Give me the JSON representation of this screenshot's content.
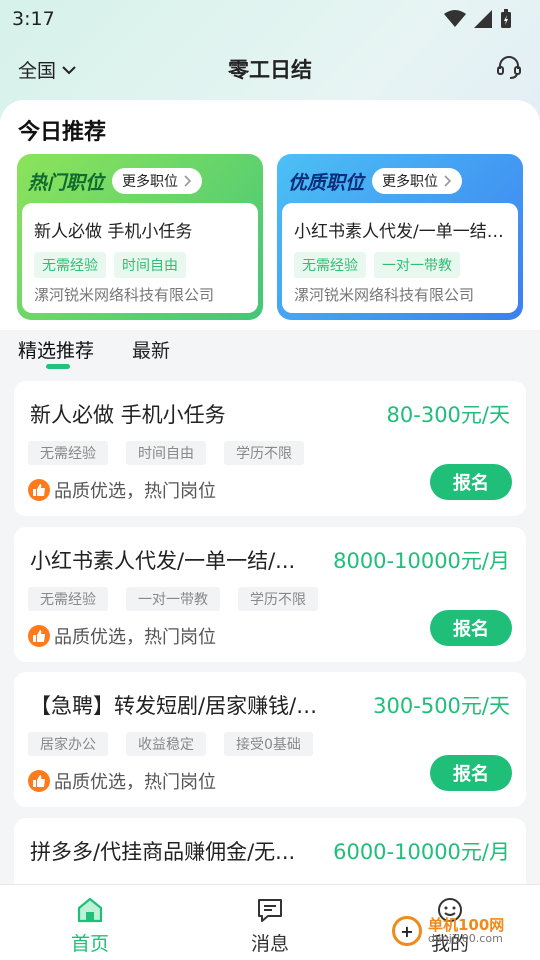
{
  "status_bar": {
    "time": "3:17"
  },
  "header": {
    "region": "全国",
    "title": "零工日结"
  },
  "section": {
    "title": "今日推荐"
  },
  "promos": [
    {
      "heading": "热门职位",
      "more": "更多职位",
      "job": "新人必做 手机小任务",
      "tags": [
        "无需经验",
        "时间自由"
      ],
      "company": "漯河锐米网络科技有限公司"
    },
    {
      "heading": "优质职位",
      "more": "更多职位",
      "job": "小红书素人代发/一单一结/...",
      "tags": [
        "无需经验",
        "一对一带教"
      ],
      "company": "漯河锐米网络科技有限公司"
    }
  ],
  "tabs": {
    "active": "精选推荐",
    "inactive": "最新"
  },
  "jobs": [
    {
      "title": "新人必做 手机小任务",
      "salary": "80-300元/天",
      "tags": [
        "无需经验",
        "时间自由",
        "学历不限"
      ],
      "quality": "品质优选，热门岗位",
      "apply": "报名"
    },
    {
      "title": "小红书素人代发/一单一结/...",
      "salary": "8000-10000元/月",
      "tags": [
        "无需经验",
        "一对一带教",
        "学历不限"
      ],
      "quality": "品质优选，热门岗位",
      "apply": "报名"
    },
    {
      "title": "【急聘】转发短剧/居家赚钱/日结",
      "salary": "300-500元/天",
      "tags": [
        "居家办公",
        "收益稳定",
        "接受0基础"
      ],
      "quality": "品质优选，热门岗位",
      "apply": "报名"
    },
    {
      "title": "拼多多/代挂商品赚佣金/无...",
      "salary": "6000-10000元/月",
      "tags": [],
      "quality": "",
      "apply": ""
    }
  ],
  "nav": {
    "home": "首页",
    "messages": "消息",
    "mine": "我的"
  },
  "watermark": {
    "line1": "单机100网",
    "line2": "danji100.com"
  },
  "colors": {
    "accent": "#1fbf7a",
    "orange": "#ff7a1a"
  }
}
